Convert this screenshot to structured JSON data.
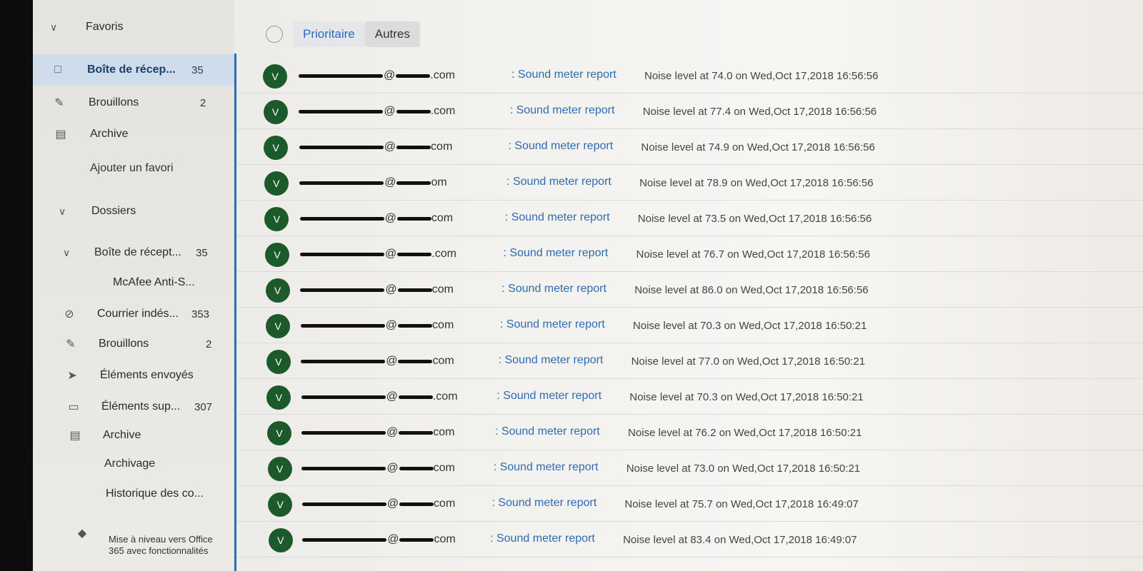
{
  "nav": {
    "favorites": {
      "label": "Favoris"
    },
    "fav_items": [
      {
        "label": "Boîte de récep...",
        "count": "35",
        "icon": "inbox-icon"
      },
      {
        "label": "Brouillons",
        "count": "2",
        "icon": "pencil-icon"
      },
      {
        "label": "Archive",
        "count": "",
        "icon": "archive-icon"
      },
      {
        "label": "Ajouter un favori",
        "count": "",
        "icon": ""
      }
    ],
    "folders": {
      "label": "Dossiers"
    },
    "folder_items": [
      {
        "label": "Boîte de récept...",
        "count": "35",
        "icon": "chevron-down-icon"
      },
      {
        "label": "McAfee Anti-S...",
        "count": "",
        "icon": ""
      },
      {
        "label": "Courrier indés...",
        "count": "353",
        "icon": "blocked-icon"
      },
      {
        "label": "Brouillons",
        "count": "2",
        "icon": "pencil-icon"
      },
      {
        "label": "Éléments envoyés",
        "count": "",
        "icon": "send-icon"
      },
      {
        "label": "Éléments sup...",
        "count": "307",
        "icon": "trash-icon"
      },
      {
        "label": "Archive",
        "count": "",
        "icon": "archive-icon"
      },
      {
        "label": "Archivage",
        "count": "",
        "icon": ""
      },
      {
        "label": "Historique des co...",
        "count": "",
        "icon": ""
      }
    ],
    "promo": "Mise à niveau vers Office 365 avec fonctionnalités"
  },
  "tabs": {
    "focused": "Prioritaire",
    "other": "Autres"
  },
  "emails": [
    {
      "initial": "V",
      "domain": ".com",
      "subject": ": Sound meter report",
      "preview": "Noise level at 74.0 on Wed,Oct 17,2018 16:56:56"
    },
    {
      "initial": "V",
      "domain": ".com",
      "subject": ": Sound meter report",
      "preview": "Noise level at 77.4 on Wed,Oct 17,2018 16:56:56"
    },
    {
      "initial": "V",
      "domain": "com",
      "subject": ": Sound meter report",
      "preview": "Noise level at 74.9 on Wed,Oct 17,2018 16:56:56"
    },
    {
      "initial": "V",
      "domain": "om",
      "subject": ": Sound meter report",
      "preview": "Noise level at 78.9 on Wed,Oct 17,2018 16:56:56"
    },
    {
      "initial": "V",
      "domain": "com",
      "subject": ": Sound meter report",
      "preview": "Noise level at 73.5 on Wed,Oct 17,2018 16:56:56"
    },
    {
      "initial": "V",
      "domain": ".com",
      "subject": ": Sound meter report",
      "preview": "Noise level at 76.7 on Wed,Oct 17,2018 16:56:56"
    },
    {
      "initial": "V",
      "domain": "com",
      "subject": ": Sound meter report",
      "preview": "Noise level at 86.0 on Wed,Oct 17,2018 16:56:56"
    },
    {
      "initial": "V",
      "domain": "com",
      "subject": ": Sound meter report",
      "preview": "Noise level at 70.3 on Wed,Oct 17,2018 16:50:21"
    },
    {
      "initial": "V",
      "domain": "com",
      "subject": ": Sound meter report",
      "preview": "Noise level at 77.0 on Wed,Oct 17,2018 16:50:21"
    },
    {
      "initial": "V",
      "domain": ".com",
      "subject": ": Sound meter report",
      "preview": "Noise level at 70.3 on Wed,Oct 17,2018 16:50:21"
    },
    {
      "initial": "V",
      "domain": "com",
      "subject": ": Sound meter report",
      "preview": "Noise level at 76.2 on Wed,Oct 17,2018 16:50:21"
    },
    {
      "initial": "V",
      "domain": "com",
      "subject": ": Sound meter report",
      "preview": "Noise level at 73.0 on Wed,Oct 17,2018 16:50:21"
    },
    {
      "initial": "V",
      "domain": "com",
      "subject": ": Sound meter report",
      "preview": "Noise level at 75.7 on Wed,Oct 17,2018 16:49:07"
    },
    {
      "initial": "V",
      "domain": "com",
      "subject": ": Sound meter report",
      "preview": "Noise level at 83.4 on Wed,Oct 17,2018 16:49:07"
    }
  ]
}
